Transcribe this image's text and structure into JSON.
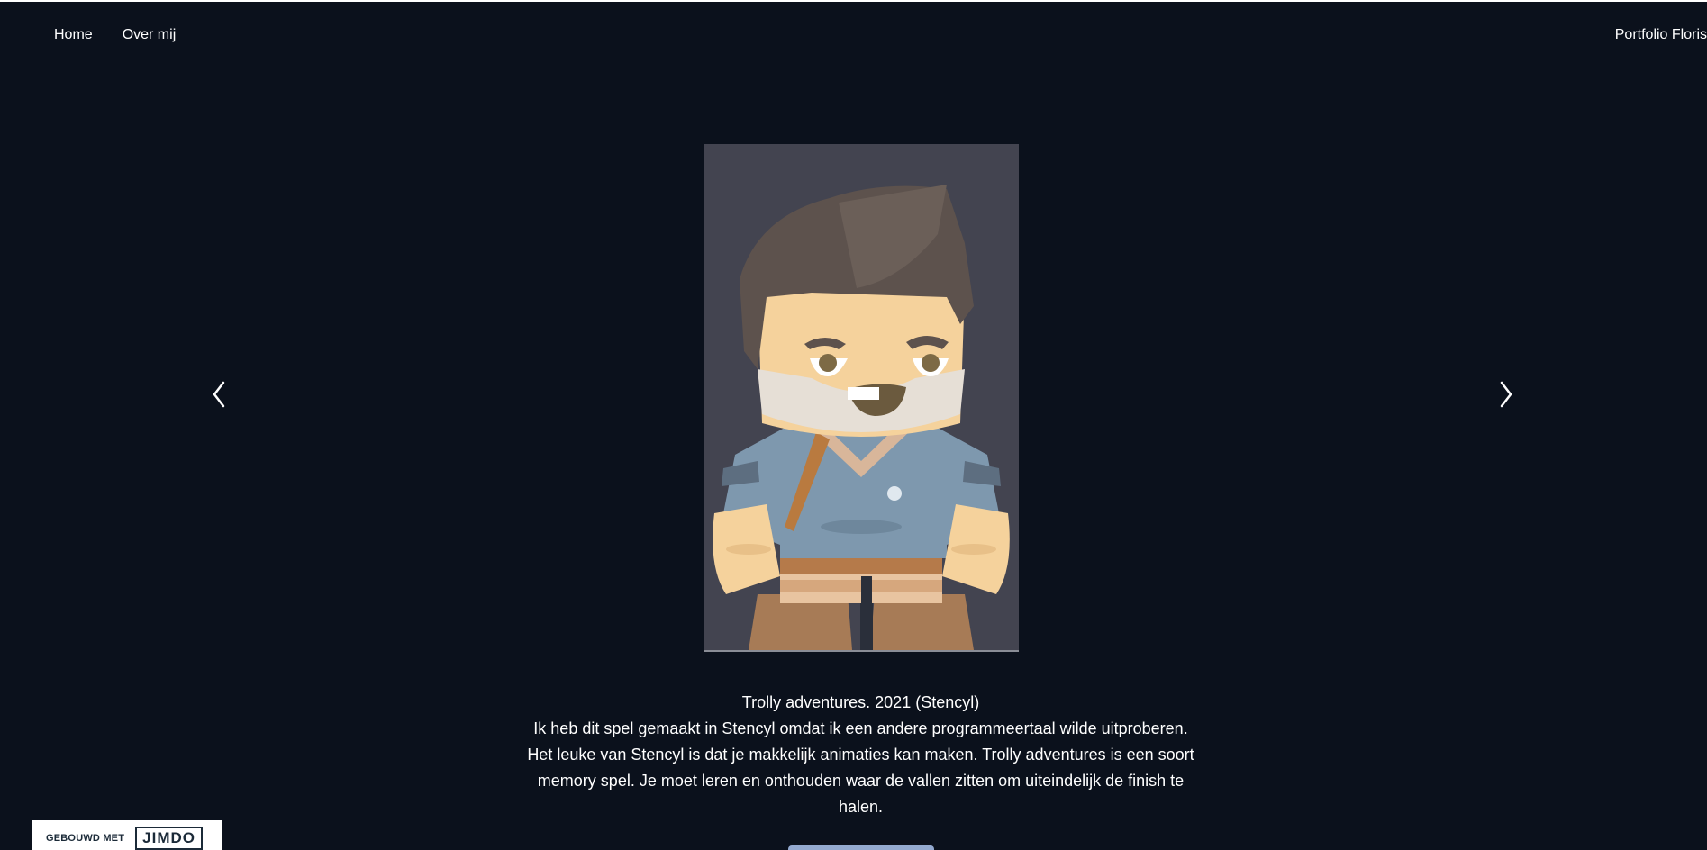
{
  "nav": {
    "items": [
      {
        "label": "Home"
      },
      {
        "label": "Over mij"
      }
    ],
    "brand": "Portfolio Floris"
  },
  "slider": {
    "prev_icon": "chevron-left-icon",
    "next_icon": "chevron-right-icon"
  },
  "project": {
    "title": "Trolly adventures. 2021 (Stencyl)",
    "description": "Ik heb dit spel gemaakt in Stencyl omdat ik een andere programmeertaal wilde uitproberen. Het leuke van Stencyl is dat je makkelijk animaties kan maken. Trolly adventures is een soort memory spel. Je moet leren en onthouden waar de vallen zitten om uiteindelijk de finish te halen."
  },
  "badge": {
    "built_with": "GEBOUWD MET",
    "logo": "JIMDO"
  },
  "colors": {
    "background": "#0b111c",
    "image_background": "#434450",
    "button": "#93a9cf"
  }
}
